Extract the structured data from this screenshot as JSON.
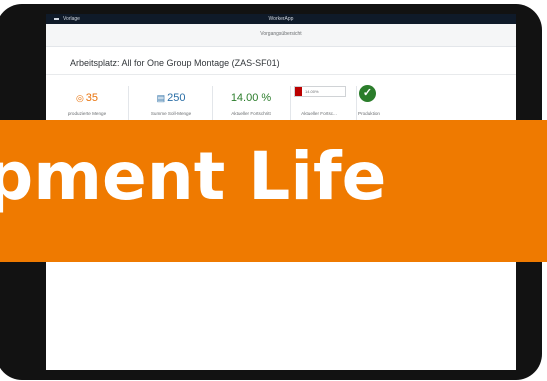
{
  "statusbar": {
    "left_label": "Vorlage",
    "app_title": "WorkerApp"
  },
  "subheader": {
    "title": "Vorgangsübersicht"
  },
  "page": {
    "title": "Arbeitsplatz: All for One Group Montage (ZAS-SF01)"
  },
  "kpis": [
    {
      "value": "35",
      "label": "produzierte Menge",
      "icon": "target-icon",
      "color": "#e9730c"
    },
    {
      "value": "250",
      "label": "Summe Soll-Menge",
      "icon": "bar-chart-icon",
      "color": "#2a6ea6"
    },
    {
      "value": "14.00 %",
      "label": "Aktueller Fortschritt",
      "icon": "percent-icon",
      "color": "#2b7d2b"
    },
    {
      "value": "14.00%",
      "label": "Aktueller Fortsc...",
      "icon": "progress-bar",
      "color": "#bb0000",
      "progress": 0.14
    },
    {
      "value": "",
      "label": "Produktion",
      "icon": "checkmark-icon",
      "color": "#2b7d2b"
    }
  ],
  "banner": {
    "text": "pment Life"
  }
}
